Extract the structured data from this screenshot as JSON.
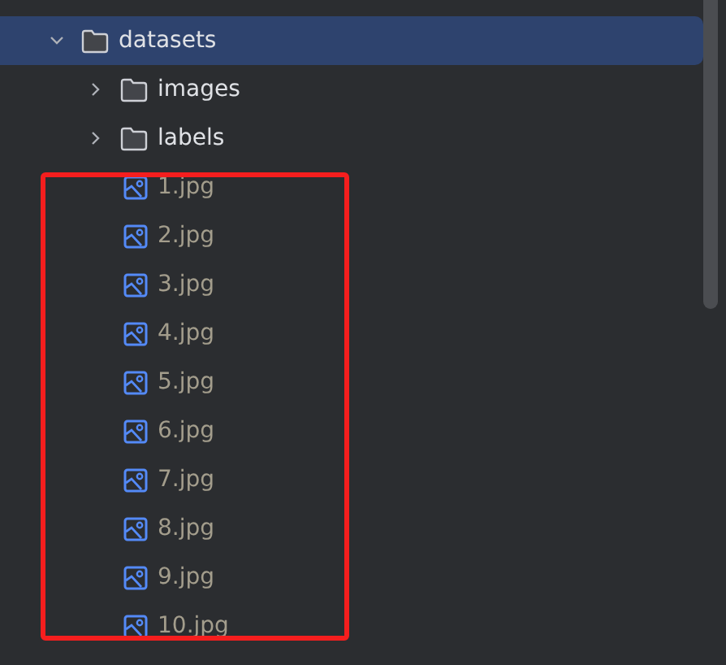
{
  "tree": [
    {
      "name": "datasets",
      "kind": "folder",
      "expanded": true,
      "selected": true,
      "children": [
        {
          "name": "images",
          "kind": "folder",
          "expanded": false,
          "selected": false
        },
        {
          "name": "labels",
          "kind": "folder",
          "expanded": false,
          "selected": false
        },
        {
          "name": "1.jpg",
          "kind": "image",
          "selected": false
        },
        {
          "name": "2.jpg",
          "kind": "image",
          "selected": false
        },
        {
          "name": "3.jpg",
          "kind": "image",
          "selected": false
        },
        {
          "name": "4.jpg",
          "kind": "image",
          "selected": false
        },
        {
          "name": "5.jpg",
          "kind": "image",
          "selected": false
        },
        {
          "name": "6.jpg",
          "kind": "image",
          "selected": false
        },
        {
          "name": "7.jpg",
          "kind": "image",
          "selected": false
        },
        {
          "name": "8.jpg",
          "kind": "image",
          "selected": false
        },
        {
          "name": "9.jpg",
          "kind": "image",
          "selected": false
        },
        {
          "name": "10.jpg",
          "kind": "image",
          "selected": false
        }
      ]
    }
  ]
}
